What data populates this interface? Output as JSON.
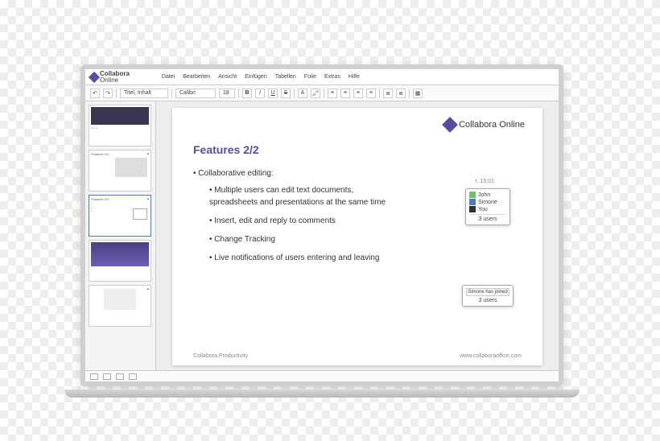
{
  "brand": {
    "line1": "Collabora",
    "line2": "Online"
  },
  "menu": [
    "Datei",
    "Bearbeiten",
    "Ansicht",
    "Einfügen",
    "Tabellen",
    "Folie",
    "Extras",
    "Hilfe"
  ],
  "toolbar": {
    "layout_field": "Titel, Inhalt",
    "font_field": "Calibri",
    "size_field": "18",
    "bold": "B",
    "italic": "I",
    "underline": "U",
    "strike": "S"
  },
  "slide": {
    "logo_text": "Collabora Online",
    "title": "Features 2/2",
    "bullet_main": "Collaborative editing:",
    "subs": [
      "Multiple users can edit text documents, spreadsheets and presentations at the same time",
      "Insert, edit and reply to comments",
      "Change Tracking",
      "Live notifications of users entering and leaving"
    ],
    "footer_left": "Collabora Productivity",
    "footer_right": "www.collaboraoffice.com"
  },
  "timecode": "r. 15:01",
  "popover_users": {
    "rows": [
      {
        "color": "#6ec16e",
        "name": "John"
      },
      {
        "color": "#4a7ebb",
        "name": "Simone"
      },
      {
        "color": "#333333",
        "name": "You"
      }
    ],
    "footer": "3 users"
  },
  "popover_notify": {
    "note": "Simone has joined",
    "footer": "3 users"
  },
  "thumb_title_features12": "Features 1/2",
  "thumb_title_features22": "Features 2/2"
}
